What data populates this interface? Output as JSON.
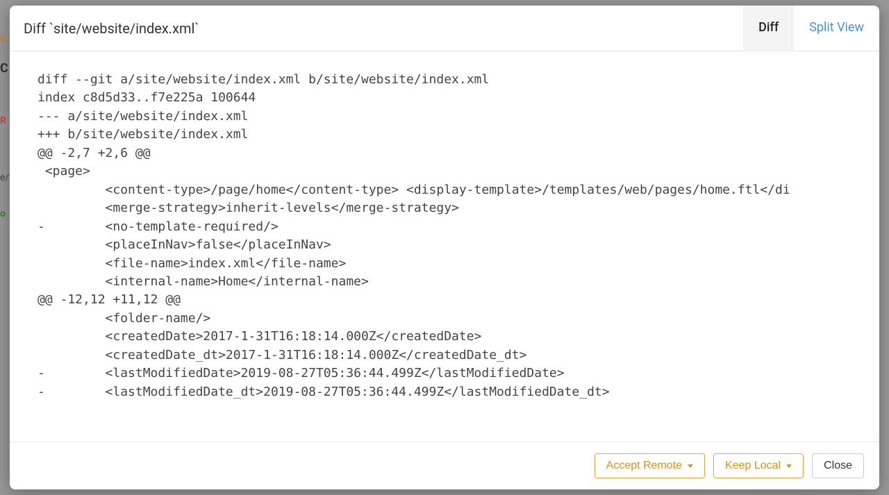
{
  "header": {
    "title": "Diff `site/website/index.xml`",
    "tabs": {
      "diff": "Diff",
      "split": "Split View"
    }
  },
  "diff": {
    "lines": [
      "diff --git a/site/website/index.xml b/site/website/index.xml",
      "index c8d5d33..f7e225a 100644",
      "--- a/site/website/index.xml",
      "+++ b/site/website/index.xml",
      "@@ -2,7 +2,6 @@",
      " <page>",
      "         <content-type>/page/home</content-type> <display-template>/templates/web/pages/home.ftl</di",
      "         <merge-strategy>inherit-levels</merge-strategy>",
      "-        <no-template-required/>",
      "         <placeInNav>false</placeInNav>",
      "         <file-name>index.xml</file-name>",
      "         <internal-name>Home</internal-name>",
      "@@ -12,12 +11,12 @@",
      "         <folder-name/>",
      "         <createdDate>2017-1-31T16:18:14.000Z</createdDate>",
      "         <createdDate_dt>2017-1-31T16:18:14.000Z</createdDate_dt>",
      "-        <lastModifiedDate>2019-08-27T05:36:44.499Z</lastModifiedDate>",
      "-        <lastModifiedDate_dt>2019-08-27T05:36:44.499Z</lastModifiedDate_dt>"
    ]
  },
  "footer": {
    "accept_remote": "Accept Remote",
    "keep_local": "Keep Local",
    "close": "Close"
  },
  "backdrop": {
    "o": "o",
    "c": "C",
    "r": "R",
    "el": "e/l",
    "g": "o"
  }
}
